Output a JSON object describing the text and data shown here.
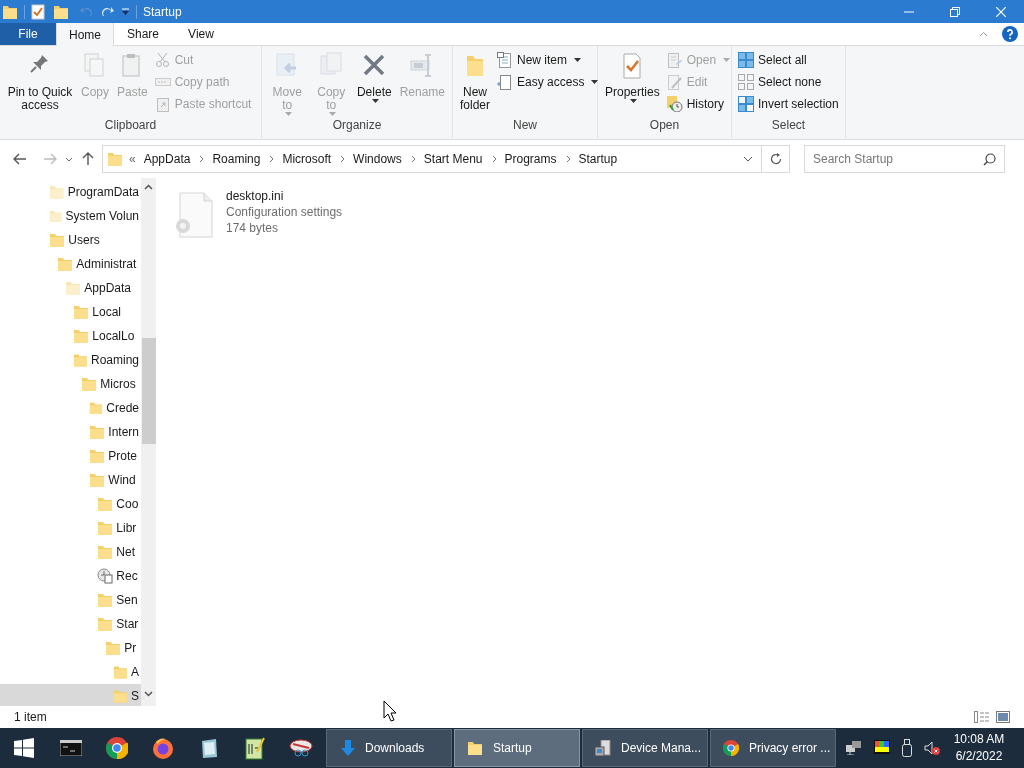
{
  "window": {
    "title": "Startup"
  },
  "ribbon_tabs": [
    {
      "label": "File",
      "kind": "file"
    },
    {
      "label": "Home",
      "kind": "tab",
      "selected": true
    },
    {
      "label": "Share",
      "kind": "tab",
      "selected": false
    },
    {
      "label": "View",
      "kind": "tab",
      "selected": false
    }
  ],
  "ribbon_groups": [
    {
      "label": "Clipboard",
      "items": [
        {
          "kind": "large",
          "label": "Pin to Quick access",
          "disabled": false,
          "dropdown": false
        },
        {
          "kind": "large",
          "label": "Copy",
          "disabled": true,
          "dropdown": false
        },
        {
          "kind": "large",
          "label": "Paste",
          "disabled": true,
          "dropdown": false
        },
        {
          "kind": "stack",
          "items": [
            {
              "label": "Cut",
              "disabled": true,
              "dropdown": false
            },
            {
              "label": "Copy path",
              "disabled": true,
              "dropdown": false
            },
            {
              "label": "Paste shortcut",
              "disabled": true,
              "dropdown": false
            }
          ]
        }
      ]
    },
    {
      "label": "Organize",
      "items": [
        {
          "kind": "large",
          "label": "Move to",
          "disabled": true,
          "dropdown": true
        },
        {
          "kind": "large",
          "label": "Copy to",
          "disabled": true,
          "dropdown": true
        },
        {
          "kind": "large",
          "label": "Delete",
          "disabled": false,
          "dropdown": true
        },
        {
          "kind": "large",
          "label": "Rename",
          "disabled": true,
          "dropdown": false
        }
      ]
    },
    {
      "label": "New",
      "items": [
        {
          "kind": "large",
          "label": "New folder",
          "disabled": false,
          "dropdown": false
        },
        {
          "kind": "stack",
          "items": [
            {
              "label": "New item",
              "disabled": false,
              "dropdown": true
            },
            {
              "label": "Easy access",
              "disabled": false,
              "dropdown": true
            }
          ]
        }
      ]
    },
    {
      "label": "Open",
      "items": [
        {
          "kind": "large",
          "label": "Properties",
          "disabled": false,
          "dropdown": true
        },
        {
          "kind": "stack",
          "items": [
            {
              "label": "Open",
              "disabled": true,
              "dropdown": true
            },
            {
              "label": "Edit",
              "disabled": true,
              "dropdown": false
            },
            {
              "label": "History",
              "disabled": false,
              "dropdown": false
            }
          ]
        }
      ]
    },
    {
      "label": "Select",
      "items": [
        {
          "kind": "stack",
          "items": [
            {
              "label": "Select all",
              "disabled": false,
              "dropdown": false
            },
            {
              "label": "Select none",
              "disabled": false,
              "dropdown": false
            },
            {
              "label": "Invert selection",
              "disabled": false,
              "dropdown": false
            }
          ]
        }
      ]
    }
  ],
  "address_bar": {
    "overflow": "«",
    "crumbs": [
      "AppData",
      "Roaming",
      "Microsoft",
      "Windows",
      "Start Menu",
      "Programs",
      "Startup"
    ]
  },
  "search": {
    "placeholder": "Search Startup"
  },
  "nav_tree": [
    {
      "label": "ProgramData",
      "kind": "folder",
      "hidden": true,
      "selected": false
    },
    {
      "label": "System Volun",
      "kind": "folder",
      "hidden": true,
      "selected": false
    },
    {
      "label": "Users",
      "kind": "folder",
      "selected": false,
      "children": [
        {
          "label": "Administrat",
          "kind": "folder",
          "selected": false,
          "children": [
            {
              "label": "AppData",
              "kind": "folder",
              "hidden": true,
              "selected": false,
              "children": [
                {
                  "label": "Local",
                  "kind": "folder",
                  "selected": false
                },
                {
                  "label": "LocalLo",
                  "kind": "folder",
                  "selected": false
                },
                {
                  "label": "Roaming",
                  "kind": "folder",
                  "selected": false,
                  "children": [
                    {
                      "label": "Micros",
                      "kind": "folder",
                      "selected": false,
                      "children": [
                        {
                          "label": "Crede",
                          "kind": "folder",
                          "selected": false
                        },
                        {
                          "label": "Intern",
                          "kind": "folder",
                          "selected": false
                        },
                        {
                          "label": "Prote",
                          "kind": "folder",
                          "selected": false
                        },
                        {
                          "label": "Wind",
                          "kind": "folder",
                          "selected": false,
                          "children": [
                            {
                              "label": "Coo",
                              "kind": "folder",
                              "selected": false
                            },
                            {
                              "label": "Libr",
                              "kind": "folder",
                              "selected": false
                            },
                            {
                              "label": "Net",
                              "kind": "folder",
                              "selected": false
                            },
                            {
                              "label": "Rec",
                              "kind": "recent",
                              "selected": false
                            },
                            {
                              "label": "Sen",
                              "kind": "folder",
                              "selected": false
                            },
                            {
                              "label": "Star",
                              "kind": "folder",
                              "selected": false,
                              "children": [
                                {
                                  "label": "Pr",
                                  "kind": "folder",
                                  "selected": false,
                                  "children": [
                                    {
                                      "label": "A",
                                      "kind": "folder",
                                      "selected": false
                                    },
                                    {
                                      "label": "S",
                                      "kind": "folder",
                                      "selected": true
                                    }
                                  ]
                                }
                              ]
                            }
                          ]
                        }
                      ]
                    }
                  ]
                }
              ]
            }
          ]
        }
      ]
    }
  ],
  "files": [
    {
      "name": "desktop.ini",
      "type": "Configuration settings",
      "size": "174 bytes"
    }
  ],
  "status_bar": {
    "count": "1 item"
  },
  "taskbar": {
    "windows": [
      {
        "label": "Downloads",
        "kind": "downloads",
        "selected": false
      },
      {
        "label": "Startup",
        "kind": "folder",
        "selected": true
      },
      {
        "label": "Device Mana...",
        "kind": "device",
        "selected": false
      },
      {
        "label": "Privacy error ...",
        "kind": "chrome",
        "selected": false
      }
    ],
    "time": "10:08 AM",
    "date": "6/2/2022"
  }
}
